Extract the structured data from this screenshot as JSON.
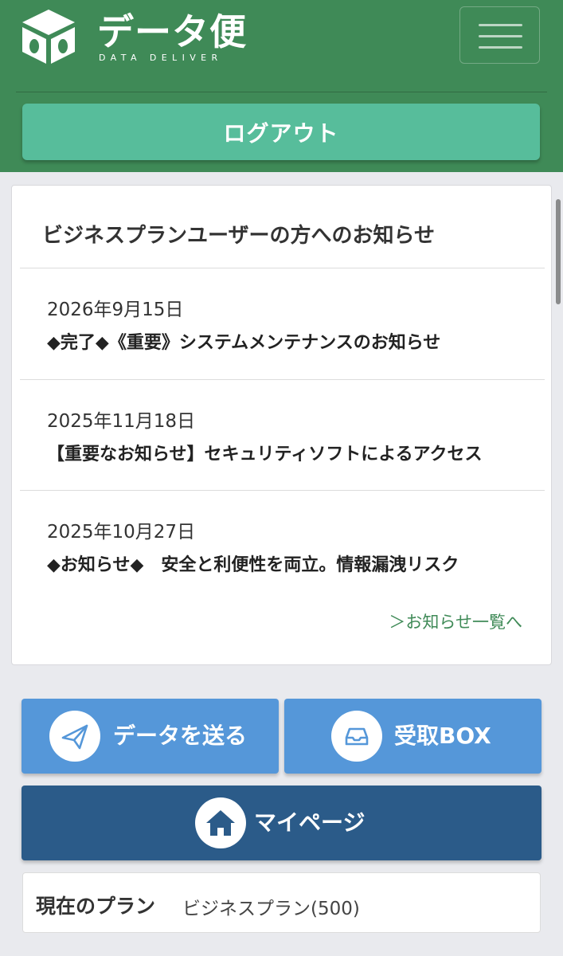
{
  "header": {
    "logo_title": "データ便",
    "logo_subtitle": "DATA DELIVER",
    "menu_icon": "hamburger-icon",
    "logout_label": "ログアウト",
    "colors": {
      "header_bg": "#3f8a57",
      "logout_bg": "#57bd9b"
    }
  },
  "news": {
    "heading": "ビジネスプランユーザーの方へのお知らせ",
    "items": [
      {
        "date": "2026年9月15日",
        "title": "◆完了◆《重要》システムメンテナンスのお知らせ"
      },
      {
        "date": "2025年11月18日",
        "title": "【重要なお知らせ】セキュリティソフトによるアクセス"
      },
      {
        "date": "2025年10月27日",
        "title": "◆お知らせ◆　安全と利便性を両立。情報漏洩リスク"
      }
    ],
    "more_link": "＞お知らせ一覧へ"
  },
  "actions": {
    "send": {
      "label": "データを送る",
      "icon": "paper-plane-icon"
    },
    "receive": {
      "label": "受取BOX",
      "icon": "inbox-tray-icon"
    },
    "mypage": {
      "label": "マイページ",
      "icon": "home-icon"
    },
    "colors": {
      "primary": "#5597d9",
      "dark": "#2b5b89"
    }
  },
  "plan": {
    "label": "現在のプラン",
    "value": "ビジネスプラン(500)"
  }
}
